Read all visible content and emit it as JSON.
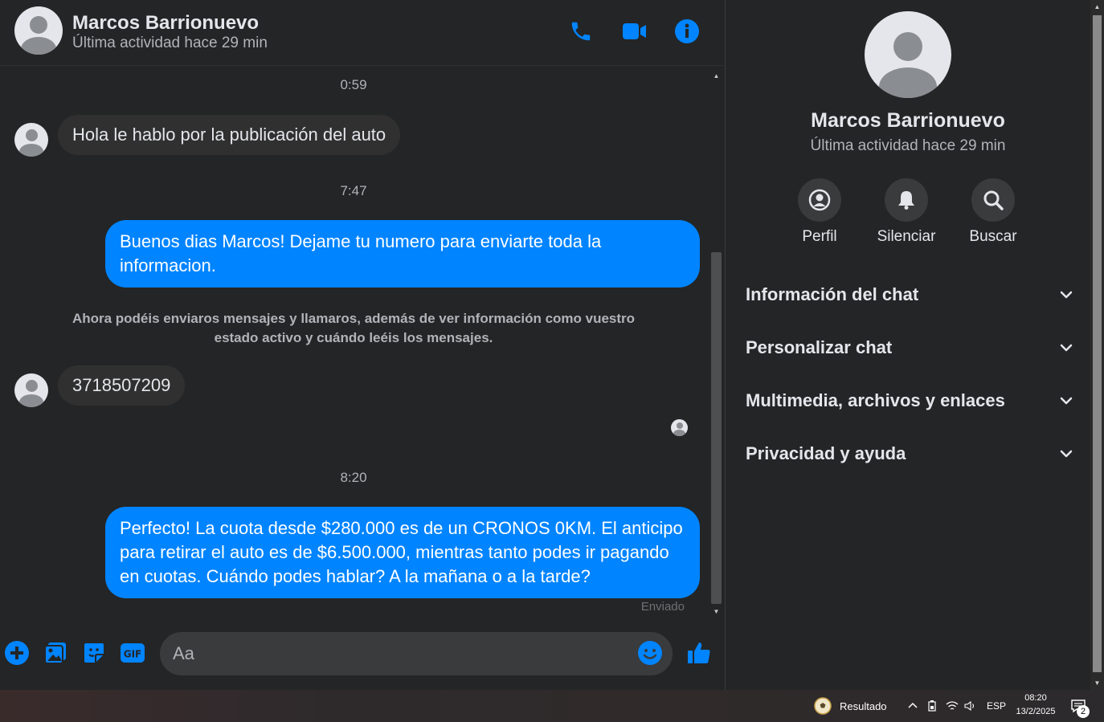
{
  "header": {
    "name": "Marcos Barrionuevo",
    "status": "Última actividad hace 29 min"
  },
  "messages": {
    "timestamps": [
      "0:59",
      "7:47",
      "8:20"
    ],
    "incoming_1": "Hola le hablo por la publicación del auto",
    "outgoing_1": "Buenos dias Marcos! Dejame tu numero para enviarte toda la informacion.",
    "notice": "Ahora podéis enviaros mensajes y llamaros, además de ver información como vuestro estado activo y cuándo leéis los mensajes.",
    "incoming_2": "3718507209",
    "outgoing_2": "Perfecto! La cuota desde $280.000 es de un CRONOS 0KM. El anticipo para retirar el auto es de $6.500.000, mientras tanto podes ir pagando en cuotas. Cuándo podes hablar? A la mañana o a la tarde?",
    "sent_label": "Enviado"
  },
  "composer": {
    "placeholder": "Aa"
  },
  "info_panel": {
    "name": "Marcos Barrionuevo",
    "status": "Última actividad hace 29 min",
    "actions": [
      "Perfil",
      "Silenciar",
      "Buscar"
    ],
    "sections": [
      "Información del chat",
      "Personalizar chat",
      "Multimedia, archivos y enlaces",
      "Privacidad y ayuda"
    ]
  },
  "taskbar": {
    "weather_label": "Resultado",
    "language": "ESP",
    "time": "08:20",
    "date": "13/2/2025",
    "notification_count": "2"
  },
  "colors": {
    "accent": "#0084ff",
    "background": "#242526",
    "bubble_incoming": "#303030"
  },
  "icons": [
    "phone-icon",
    "video-icon",
    "info-icon",
    "plus-icon",
    "image-icon",
    "sticker-icon",
    "gif-icon",
    "emoji-icon",
    "like-icon",
    "profile-icon",
    "bell-icon",
    "search-icon",
    "chevron-down-icon"
  ]
}
